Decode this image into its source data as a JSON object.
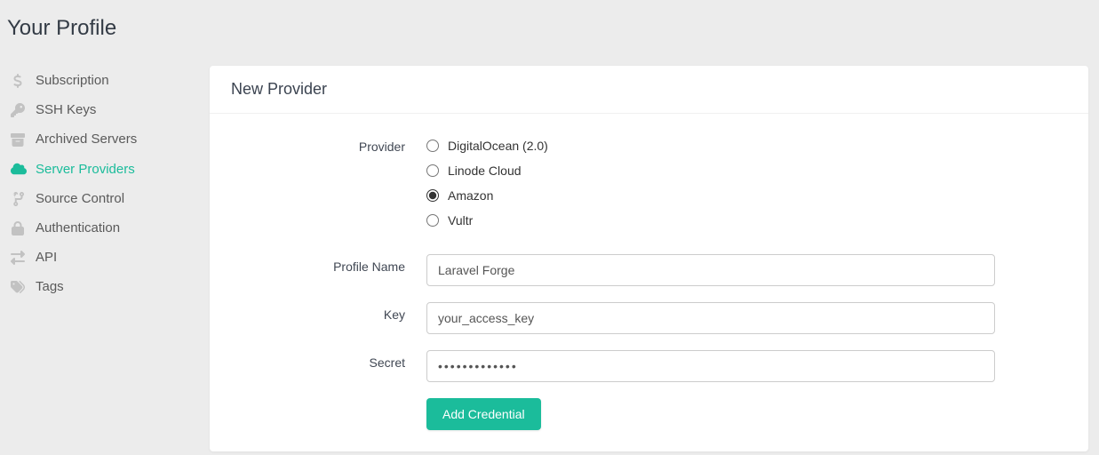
{
  "page_title": "Your Profile",
  "sidebar": {
    "items": [
      {
        "label": "Subscription",
        "icon": "dollar-icon",
        "active": false
      },
      {
        "label": "SSH Keys",
        "icon": "key-icon",
        "active": false
      },
      {
        "label": "Archived Servers",
        "icon": "archive-icon",
        "active": false
      },
      {
        "label": "Server Providers",
        "icon": "cloud-icon",
        "active": true
      },
      {
        "label": "Source Control",
        "icon": "branch-icon",
        "active": false
      },
      {
        "label": "Authentication",
        "icon": "lock-icon",
        "active": false
      },
      {
        "label": "API",
        "icon": "swap-icon",
        "active": false
      },
      {
        "label": "Tags",
        "icon": "tags-icon",
        "active": false
      }
    ]
  },
  "panel": {
    "title": "New Provider",
    "labels": {
      "provider": "Provider",
      "profile_name": "Profile Name",
      "key": "Key",
      "secret": "Secret"
    },
    "providers": [
      {
        "label": "DigitalOcean (2.0)",
        "selected": false
      },
      {
        "label": "Linode Cloud",
        "selected": false
      },
      {
        "label": "Amazon",
        "selected": true
      },
      {
        "label": "Vultr",
        "selected": false
      }
    ],
    "inputs": {
      "profile_name": {
        "value": "Laravel Forge"
      },
      "key": {
        "value": "your_access_key"
      },
      "secret": {
        "value": "•••••••••••••"
      }
    },
    "submit_label": "Add Credential"
  }
}
